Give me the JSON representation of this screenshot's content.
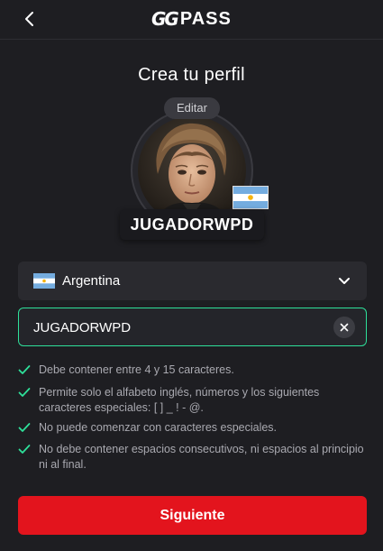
{
  "header": {
    "logo_gg": "GG",
    "logo_pass": "PASS"
  },
  "title": "Crea tu perfil",
  "avatar": {
    "edit_label": "Editar",
    "flag": "argentina-flag"
  },
  "nickname_display": "JUGADORWPD",
  "country": {
    "selected": "Argentina"
  },
  "nickname_input": {
    "value": "JUGADORWPD"
  },
  "rules": [
    {
      "text": "Debe contener entre 4 y 15 caracteres."
    },
    {
      "text": "Permite solo el alfabeto inglés, números y los siguientes caracteres especiales: [ ] _ ! - @."
    },
    {
      "text": "No puede comenzar con caracteres especiales."
    },
    {
      "text": "No debe contener espacios consecutivos, ni espacios al principio ni al final."
    }
  ],
  "next_button": "Siguiente",
  "colors": {
    "background": "#1e1e22",
    "accent_red": "#e3141d",
    "valid_green": "#2ee09a",
    "argentina_blue": "#74acdf"
  }
}
